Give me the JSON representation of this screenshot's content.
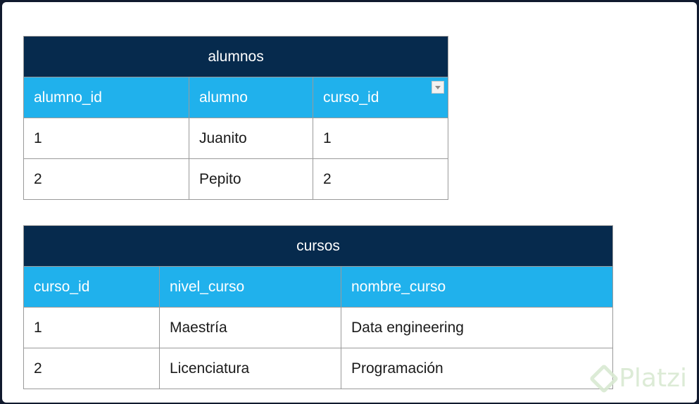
{
  "alumnos": {
    "title": "alumnos",
    "columns": [
      "alumno_id",
      "alumno",
      "curso_id"
    ],
    "rows": [
      [
        "1",
        "Juanito",
        "1"
      ],
      [
        "2",
        "Pepito",
        "2"
      ]
    ]
  },
  "cursos": {
    "title": "cursos",
    "columns": [
      "curso_id",
      "nivel_curso",
      "nombre_curso"
    ],
    "rows": [
      [
        "1",
        "Maestría",
        "Data engineering"
      ],
      [
        "2",
        "Licenciatura",
        "Programación"
      ]
    ]
  },
  "watermark": {
    "text": "Platzi"
  },
  "colors": {
    "title_bg": "#062a4d",
    "header_bg": "#20b1ec",
    "border": "#9a9a9a"
  }
}
